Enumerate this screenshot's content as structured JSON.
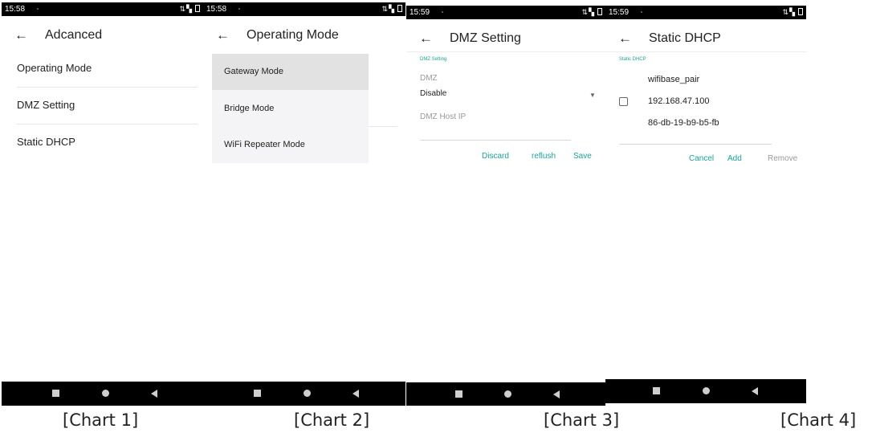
{
  "colors": {
    "accent": "#19a596",
    "statusbar": "#000000",
    "selected_item": "#e2e2e2"
  },
  "screens": [
    {
      "status_time": "15:58",
      "title": "Adcanced",
      "items": [
        "Operating Mode",
        "DMZ Setting",
        "Static DHCP"
      ]
    },
    {
      "status_time": "15:58",
      "title": "Operating Mode",
      "options": [
        "Gateway Mode",
        "Bridge Mode",
        "WiFi Repeater Mode"
      ],
      "selected": "Gateway Mode"
    },
    {
      "status_time": "15:59",
      "title": "DMZ Setting",
      "section_caption": "DMZ Setting",
      "dmz_label": "DMZ",
      "dmz_value": "Disable",
      "host_ip_placeholder": "DMZ Host IP",
      "buttons": {
        "discard": "Discard",
        "reflush": "reflush",
        "save": "Save"
      }
    },
    {
      "status_time": "15:59",
      "title": "Static DHCP",
      "section_caption": "Static DHCP",
      "entry": {
        "name": "wifibase_pair",
        "ip": "192.168.47.100",
        "mac": "86-db-19-b9-b5-fb",
        "checked": false
      },
      "buttons": {
        "cancel": "Cancel",
        "add": "Add",
        "remove": "Remove"
      }
    }
  ],
  "icons": {
    "back": "arrow-left-icon",
    "dropdown": "caret-down-icon",
    "nav": [
      "recents-square-icon",
      "home-circle-icon",
      "back-triangle-icon"
    ]
  },
  "captions": [
    "[Chart 1]",
    "[Chart 2]",
    "[Chart 3]",
    "[Chart 4]"
  ]
}
